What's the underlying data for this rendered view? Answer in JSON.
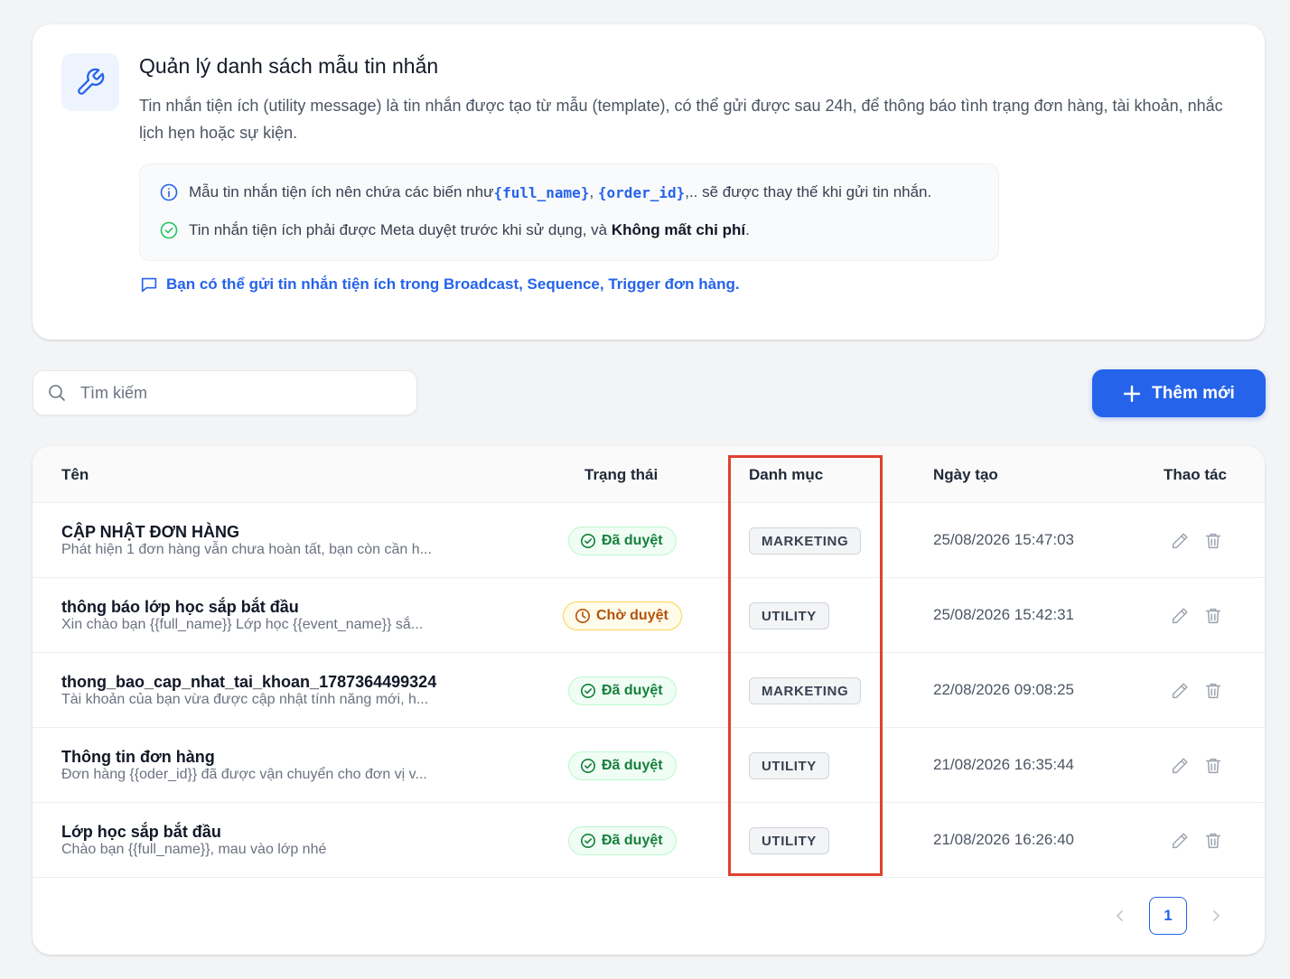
{
  "header": {
    "title": "Quản lý danh sách mẫu tin nhắn",
    "description": "Tin nhắn tiện ích (utility message) là tin nhắn được tạo từ mẫu (template), có thể gửi được sau 24h, để thông báo tình trạng đơn hàng, tài khoản, nhắc lịch hẹn hoặc sự kiện.",
    "icon": "wrench-icon"
  },
  "notes": {
    "note1": {
      "icon": "info-icon",
      "prefix": "Mẫu tin nhắn tiện ích nên chứa các biến như ",
      "var1": "{full_name}",
      "sep": ", ",
      "var2": "{order_id}",
      "suffix": ",.. sẽ được thay thế khi gửi tin nhắn."
    },
    "note2": {
      "icon": "check-circle-icon",
      "prefix": "Tin nhắn tiện ích phải được Meta duyệt trước khi sử dụng, và ",
      "bold": "Không mất chi phí",
      "suffix": "."
    }
  },
  "hint": {
    "icon": "chat-icon",
    "text": "Bạn có thể gửi tin nhắn tiện ích trong Broadcast, Sequence, Trigger đơn hàng."
  },
  "search": {
    "placeholder": "Tìm kiếm",
    "value": ""
  },
  "add_button": {
    "label": "Thêm mới"
  },
  "table": {
    "columns": {
      "name": "Tên",
      "status": "Trạng thái",
      "category": "Danh mục",
      "created": "Ngày tạo",
      "actions": "Thao tác"
    },
    "rows": [
      {
        "name": "CẬP NHẬT ĐƠN HÀNG",
        "preview": "Phát hiện 1 đơn hàng vẫn chưa hoàn tất, bạn còn cần h...",
        "status": "Đã duyệt",
        "status_type": "approved",
        "category": "MARKETING",
        "created": "25/08/2026 15:47:03"
      },
      {
        "name": "thông báo lớp học sắp bắt đầu",
        "preview": "Xin chào bạn {{full_name}} Lớp học {{event_name}} sắ...",
        "status": "Chờ duyệt",
        "status_type": "pending",
        "category": "UTILITY",
        "created": "25/08/2026 15:42:31"
      },
      {
        "name": "thong_bao_cap_nhat_tai_khoan_1787364499324",
        "preview": "Tài khoản của bạn vừa được cập nhật tính năng mới, h...",
        "status": "Đã duyệt",
        "status_type": "approved",
        "category": "MARKETING",
        "created": "22/08/2026 09:08:25"
      },
      {
        "name": "Thông tin đơn hàng",
        "preview": "Đơn hàng {{oder_id}} đã được vận chuyển cho đơn vị v...",
        "status": "Đã duyệt",
        "status_type": "approved",
        "category": "UTILITY",
        "created": "21/08/2026 16:35:44"
      },
      {
        "name": "Lớp học sắp bắt đầu",
        "preview": "Chào bạn {{full_name}}, mau vào lớp nhé",
        "status": "Đã duyệt",
        "status_type": "approved",
        "category": "UTILITY",
        "created": "21/08/2026 16:26:40"
      }
    ]
  },
  "pagination": {
    "current_page": "1"
  },
  "colors": {
    "accent": "#2563eb",
    "approved": "#15803d",
    "pending": "#b45309",
    "highlight": "#e0412e"
  }
}
